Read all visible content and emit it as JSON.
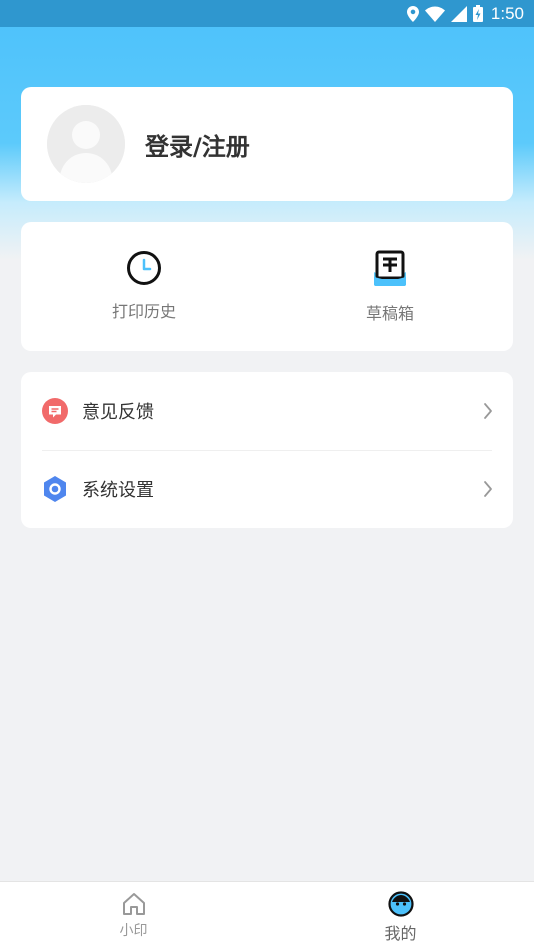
{
  "status_bar": {
    "time": "1:50"
  },
  "profile": {
    "login_label": "登录/注册"
  },
  "quick_actions": [
    {
      "label": "打印历史",
      "icon": "clock-icon"
    },
    {
      "label": "草稿箱",
      "icon": "drafts-icon"
    }
  ],
  "menu": [
    {
      "label": "意见反馈",
      "icon": "feedback-icon",
      "color": "#f16a6a"
    },
    {
      "label": "系统设置",
      "icon": "settings-hexagon-icon",
      "color": "#4f86ee"
    }
  ],
  "tabs": [
    {
      "label": "小印",
      "icon": "home-icon"
    },
    {
      "label": "我的",
      "icon": "face-icon",
      "active": true
    }
  ],
  "colors": {
    "accent": "#4cc1fb",
    "status_bar": "#2f97cf",
    "feedback": "#f16a6a",
    "settings": "#4f86ee"
  }
}
